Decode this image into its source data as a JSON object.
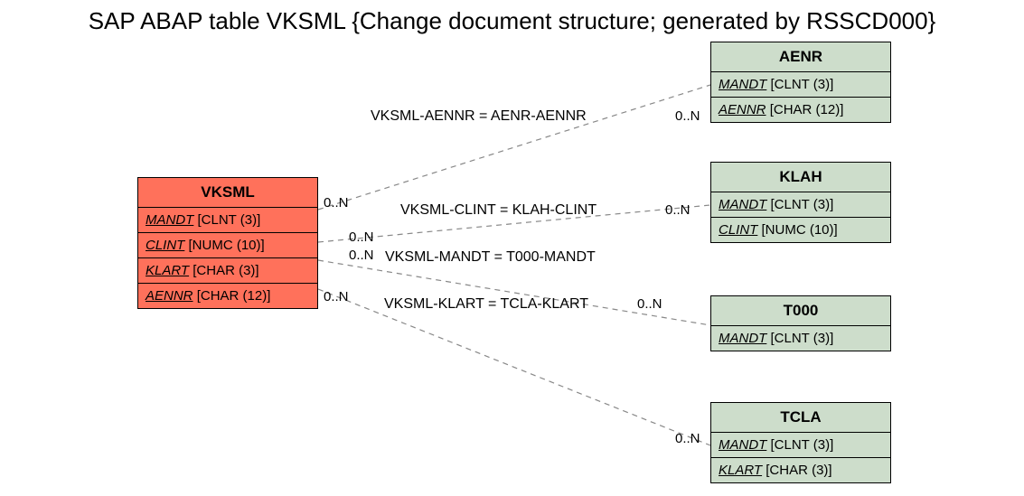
{
  "title": "SAP ABAP table VKSML {Change document structure; generated by RSSCD000}",
  "entities": {
    "vksml": {
      "name": "VKSML",
      "fields": [
        {
          "name": "MANDT",
          "type": "[CLNT (3)]"
        },
        {
          "name": "CLINT",
          "type": "[NUMC (10)]"
        },
        {
          "name": "KLART",
          "type": "[CHAR (3)]"
        },
        {
          "name": "AENNR",
          "type": "[CHAR (12)]"
        }
      ]
    },
    "aenr": {
      "name": "AENR",
      "fields": [
        {
          "name": "MANDT",
          "type": "[CLNT (3)]"
        },
        {
          "name": "AENNR",
          "type": "[CHAR (12)]"
        }
      ]
    },
    "klah": {
      "name": "KLAH",
      "fields": [
        {
          "name": "MANDT",
          "type": "[CLNT (3)]"
        },
        {
          "name": "CLINT",
          "type": "[NUMC (10)]"
        }
      ]
    },
    "t000": {
      "name": "T000",
      "fields": [
        {
          "name": "MANDT",
          "type": "[CLNT (3)]"
        }
      ]
    },
    "tcla": {
      "name": "TCLA",
      "fields": [
        {
          "name": "MANDT",
          "type": "[CLNT (3)]"
        },
        {
          "name": "KLART",
          "type": "[CHAR (3)]"
        }
      ]
    }
  },
  "relations": {
    "r1": {
      "label": "VKSML-AENNR = AENR-AENNR",
      "card_left": "0..N",
      "card_right": "0..N"
    },
    "r2": {
      "label": "VKSML-CLINT = KLAH-CLINT",
      "card_left": "0..N",
      "card_right": "0..N"
    },
    "r3": {
      "label": "VKSML-MANDT = T000-MANDT",
      "card_left": "0..N",
      "card_right": ""
    },
    "r4": {
      "label": "VKSML-KLART = TCLA-KLART",
      "card_left": "0..N",
      "card_right": "0..N"
    }
  }
}
